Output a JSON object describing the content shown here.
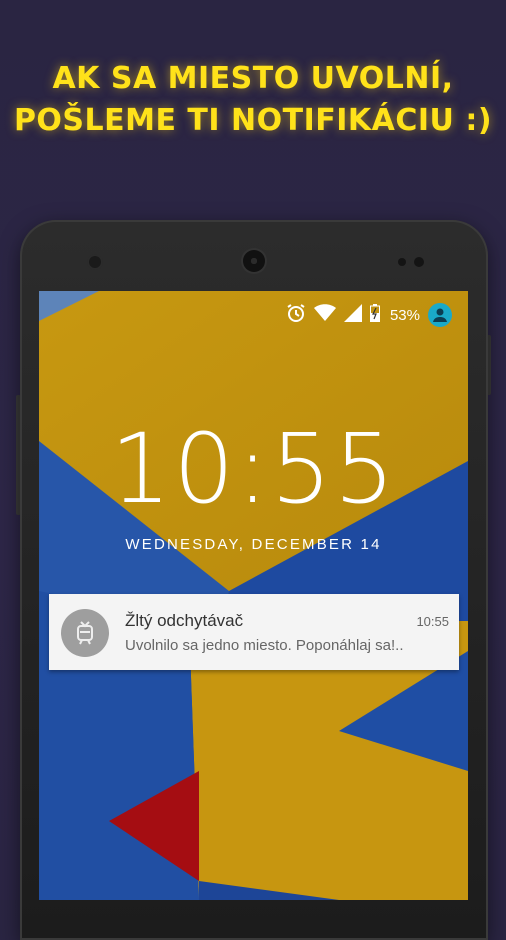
{
  "headline": {
    "line1": "AK SA MIESTO UVOLNÍ,",
    "line2": "POŠLEME TI NOTIFIKÁCIU :)"
  },
  "status_bar": {
    "icons": [
      "alarm-icon",
      "wifi-icon",
      "signal-icon",
      "battery-icon",
      "profile-icon"
    ],
    "battery_percent": "53%",
    "battery_level": 0.53
  },
  "lockscreen": {
    "time": "10:55",
    "date": "WEDNESDAY, DECEMBER 14"
  },
  "notification": {
    "app_icon": "tram-icon",
    "title": "Žltý odchytávač",
    "time": "10:55",
    "text": "Uvolnilo sa jedno miesto. Poponáhlaj sa!.."
  },
  "colors": {
    "headline": "#ffe21a",
    "background": "#2a2542",
    "wallpaper_yellow": "#c89a12",
    "wallpaper_blue": "#2a5bb0",
    "wallpaper_red": "#a50d12",
    "avatar": "#1aa9c8"
  }
}
